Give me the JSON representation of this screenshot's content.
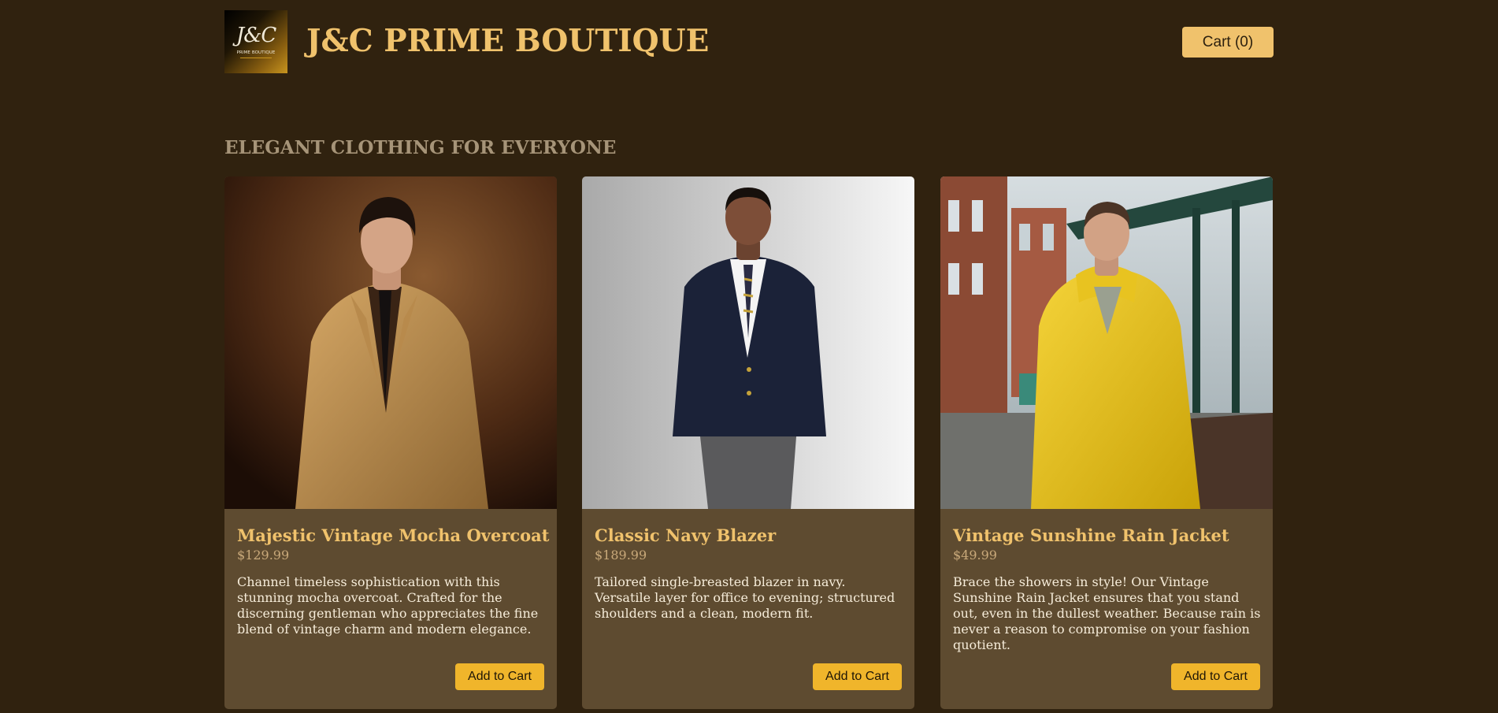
{
  "header": {
    "logo": {
      "monogram": "J&C",
      "subtitle": "PRIME BOUTIQUE"
    },
    "brand_title": "J&C PRIME BOUTIQUE",
    "cart_label": "Cart (0)"
  },
  "main": {
    "section_title": "ELEGANT CLOTHING FOR EVERYONE",
    "products": [
      {
        "name": "Majestic Vintage Mocha Overcoat",
        "price": "$129.99",
        "description": "Channel timeless sophistication with this stunning mocha overcoat. Crafted for the discerning gentleman who appreciates the fine blend of vintage charm and modern elegance.",
        "button_label": "Add to Cart",
        "image_desc": "man-in-mocha-overcoat"
      },
      {
        "name": "Classic Navy Blazer",
        "price": "$189.99",
        "description": "Tailored single-breasted blazer in navy. Versatile layer for office to evening; structured shoulders and a clean, modern fit.",
        "button_label": "Add to Cart",
        "image_desc": "man-in-navy-blazer"
      },
      {
        "name": "Vintage Sunshine Rain Jacket",
        "price": "$49.99",
        "description": "Brace the showers in style! Our Vintage Sunshine Rain Jacket ensures that you stand out, even in the dullest weather. Because rain is never a reason to compromise on your fashion quotient.",
        "button_label": "Add to Cart",
        "image_desc": "man-in-yellow-rain-jacket"
      }
    ]
  },
  "colors": {
    "page_background": "#30220f",
    "card_background": "#5e4b30",
    "accent_gold": "#f0c26c",
    "button_gold": "#f0b52b",
    "section_title": "#a69478"
  }
}
